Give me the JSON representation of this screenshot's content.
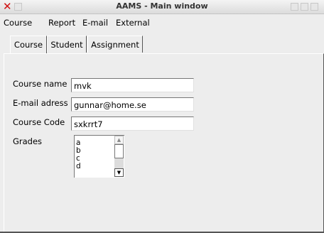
{
  "window": {
    "title": "AAMS - Main window"
  },
  "menu": {
    "items": [
      "Course",
      "Report",
      "E-mail",
      "External"
    ]
  },
  "tabs": [
    "Course",
    "Student",
    "Assignment"
  ],
  "form": {
    "course_name_label": "Course name",
    "course_name_value": "mvk",
    "email_label": "E-mail adress",
    "email_value": "gunnar@home.se",
    "course_code_label": "Course Code",
    "course_code_value": "sxkrrt7",
    "grades_label": "Grades",
    "grades": [
      "a",
      "b",
      "c",
      "d"
    ]
  },
  "icons": {
    "close": "close-icon",
    "scroll_up": "arrow-up-icon",
    "scroll_down": "arrow-down-icon"
  },
  "colors": {
    "close": "#d01010",
    "background": "#ededed"
  }
}
